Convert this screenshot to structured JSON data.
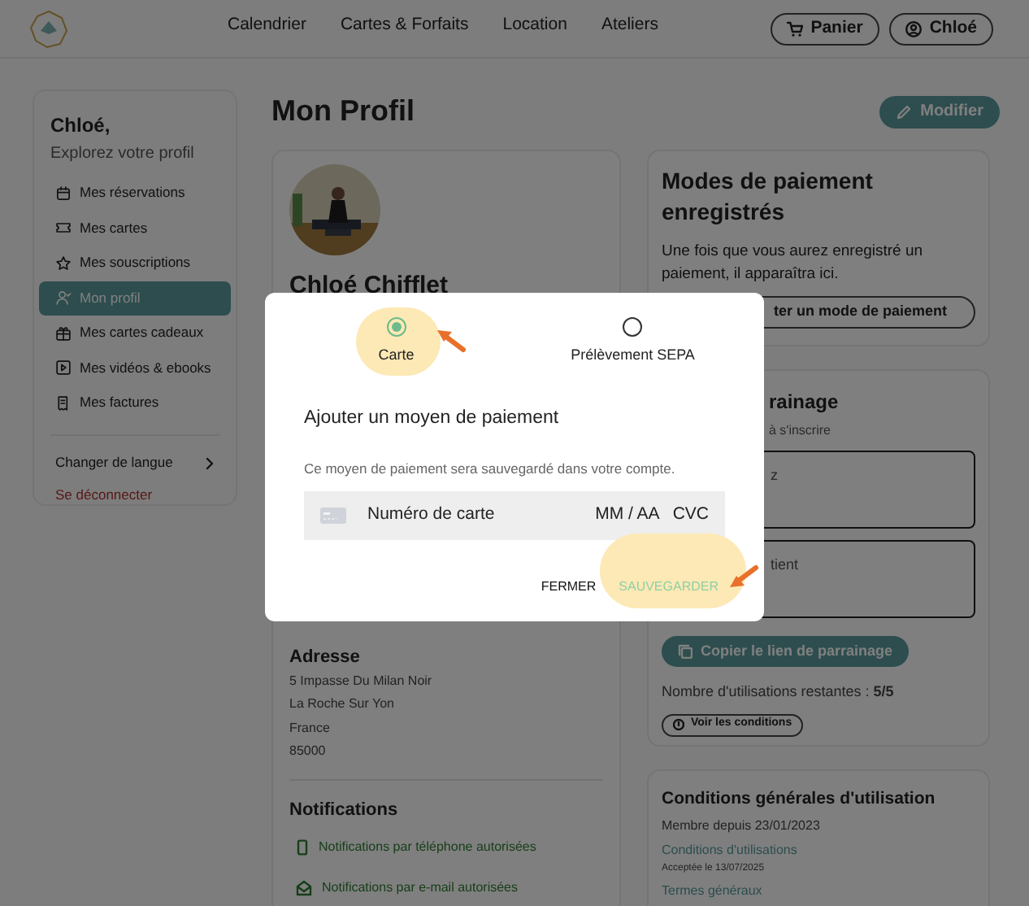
{
  "nav": {
    "links": [
      "Calendrier",
      "Cartes & Forfaits",
      "Location",
      "Ateliers"
    ],
    "cart": "Panier",
    "user": "Chloé"
  },
  "sidebar": {
    "greeting": "Chloé,",
    "subtitle": "Explorez votre profil",
    "items": [
      {
        "kind": "calendar",
        "label": "Mes réservations",
        "selected": false
      },
      {
        "kind": "ticket",
        "label": "Mes cartes",
        "selected": false
      },
      {
        "kind": "star",
        "label": "Mes souscriptions",
        "selected": false
      },
      {
        "kind": "user",
        "label": "Mon profil",
        "selected": true
      },
      {
        "kind": "gift",
        "label": "Mes cartes cadeaux",
        "selected": false
      },
      {
        "kind": "video",
        "label": "Mes vidéos & ebooks",
        "selected": false
      },
      {
        "kind": "receipt",
        "label": "Mes factures",
        "selected": false
      }
    ],
    "language": "Changer de langue",
    "logout": "Se déconnecter"
  },
  "page": {
    "title": "Mon Profil",
    "edit_button": "Modifier"
  },
  "profile": {
    "name": "Chloé Chifflet",
    "address": {
      "title": "Adresse",
      "lines": [
        "5 Impasse Du Milan Noir",
        "La Roche Sur Yon",
        "France",
        "85000"
      ]
    },
    "notifications": {
      "title": "Notifications",
      "items": [
        {
          "kind": "phone",
          "label": "Notifications par téléphone autorisées"
        },
        {
          "kind": "email",
          "label": "Notifications par e-mail autorisées"
        }
      ]
    }
  },
  "payment_card": {
    "title": "Modes de paiement enregistrés",
    "text": "Une fois que vous aurez enregistré un paiement, il apparaîtra ici.",
    "button": "ter un mode de paiement"
  },
  "referral": {
    "title": "rainage",
    "subtitle": "à s'inscrire",
    "field_1": "z",
    "field_2": "tient",
    "copy_button": "Copier le lien de parrainage",
    "remaining": "Nombre d'utilisations restantes : **5/5**",
    "conditions_button": "Voir les conditions"
  },
  "terms": {
    "title": "Conditions générales d'utilisation",
    "member_since": "Membre depuis 23/01/2023",
    "links": [
      {
        "label": "Conditions d'utilisations",
        "note": "Acceptée le 13/07/2025"
      },
      {
        "label": "Termes généraux"
      }
    ]
  },
  "modal": {
    "options": [
      {
        "label": "Carte",
        "selected": true
      },
      {
        "label": "Prélèvement SEPA",
        "selected": false
      }
    ],
    "title": "Ajouter un moyen de paiement",
    "text": "Ce moyen de paiement sera sauvegardé dans votre compte.",
    "card_field": {
      "placeholder": "Numéro de carte",
      "expiry": "MM / AA",
      "cvc": "CVC"
    },
    "buttons": [
      {
        "kind": "close",
        "label": "FERMER",
        "disabled": false
      },
      {
        "kind": "save",
        "label": "SAUVEGARDER",
        "disabled": true
      }
    ]
  }
}
